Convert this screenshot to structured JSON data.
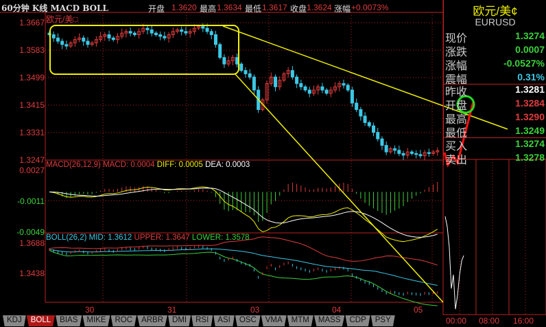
{
  "header": {
    "title": "60分钟 K线 MACD BOLL",
    "open_label": "开盘",
    "open": "1.3620",
    "high_label": "最高",
    "high": "1.3634",
    "low_label": "最低",
    "low": "1.3617",
    "close_label": "收盘",
    "close": "1.3624",
    "change_label": "涨幅",
    "change": "+0.0073%"
  },
  "main_panel": {
    "symbol_label": "欧元/美□",
    "y_ticks": [
      "1.3667",
      "1.3583",
      "1.3499",
      "1.3415",
      "1.3331",
      "1.3247"
    ]
  },
  "macd_panel": {
    "label": "MACD(26,12,9)",
    "macd": "MACD: 0.0004",
    "diff": "DIFF: 0.0005",
    "dea": "DEA: 0.0003",
    "y_ticks": [
      "0.0027",
      "-0.0011",
      "-0.0049"
    ]
  },
  "boll_panel": {
    "label": "BOLL(26,2)",
    "mid": "MID: 1.3612",
    "upper": "UPPER: 1.3647",
    "lower": "LOWER: 1.3578",
    "y_ticks": [
      "1.3688",
      "1.3438"
    ]
  },
  "x_labels": [
    "30",
    "31",
    "03",
    "04",
    "05"
  ],
  "tabs": [
    "KDJ",
    "BOLL",
    "BIAS",
    "MIKE",
    "ROC",
    "ARBR",
    "DMI",
    "RSI",
    "ASI",
    "OSC",
    "VMA",
    "MTM",
    "MASS",
    "CDP",
    "PSY"
  ],
  "active_tab": "BOLL",
  "quote": {
    "name": "欧元/美¢",
    "code": "EURUSD",
    "rows": [
      {
        "k": "现价",
        "v": "1.3274",
        "c": "#3cd23c"
      },
      {
        "k": "涨跌",
        "v": "0.0007",
        "c": "#3cd23c"
      },
      {
        "k": "涨幅",
        "v": "-0.0527%",
        "c": "#3cd23c"
      },
      {
        "k": "震幅",
        "v": "0.31%",
        "c": "#3cc8e6"
      },
      {
        "k": "昨收",
        "v": "1.3281",
        "c": "#ffffff"
      },
      {
        "k": "开盘",
        "v": "1.3284",
        "c": "#e03c3c"
      },
      {
        "k": "最高",
        "v": "1.3290",
        "c": "#e03c3c"
      },
      {
        "k": "最低",
        "v": "1.3249",
        "c": "#3cd23c"
      },
      {
        "k": "买入",
        "v": "1.3274",
        "c": "#3cd23c"
      },
      {
        "k": "卖出",
        "v": "1.3278",
        "c": "#3cd23c"
      }
    ]
  },
  "intraday_time_labels": [
    "00:00",
    "08:00",
    "16:00"
  ],
  "chart_data": {
    "type": "candlestick",
    "closes": [
      1.363,
      1.362,
      1.361,
      1.36,
      1.3595,
      1.3605,
      1.3615,
      1.362,
      1.361,
      1.36,
      1.3605,
      1.3615,
      1.3625,
      1.363,
      1.362,
      1.3615,
      1.3625,
      1.3635,
      1.364,
      1.3635,
      1.363,
      1.364,
      1.365,
      1.3645,
      1.3635,
      1.363,
      1.3625,
      1.362,
      1.363,
      1.364,
      1.3645,
      1.364,
      1.3635,
      1.364,
      1.365,
      1.3655,
      1.365,
      1.364,
      1.363,
      1.36,
      1.356,
      1.354,
      1.355,
      1.356,
      1.354,
      1.352,
      1.351,
      1.35,
      1.346,
      1.34,
      1.343,
      1.348,
      1.35,
      1.347,
      1.349,
      1.351,
      1.352,
      1.35,
      1.348,
      1.347,
      1.346,
      1.345,
      1.346,
      1.347,
      1.346,
      1.345,
      1.346,
      1.347,
      1.348,
      1.3475,
      1.346,
      1.342,
      1.34,
      1.338,
      1.336,
      1.335,
      1.333,
      1.331,
      1.329,
      1.327,
      1.328,
      1.3275,
      1.3265,
      1.326,
      1.327,
      1.3265,
      1.3262,
      1.3258,
      1.3268,
      1.3265,
      1.327,
      1.3274
    ],
    "ylim": [
      1.3247,
      1.3667
    ],
    "up_color": "#e03c3c",
    "down_color": "#3cc8e6"
  }
}
